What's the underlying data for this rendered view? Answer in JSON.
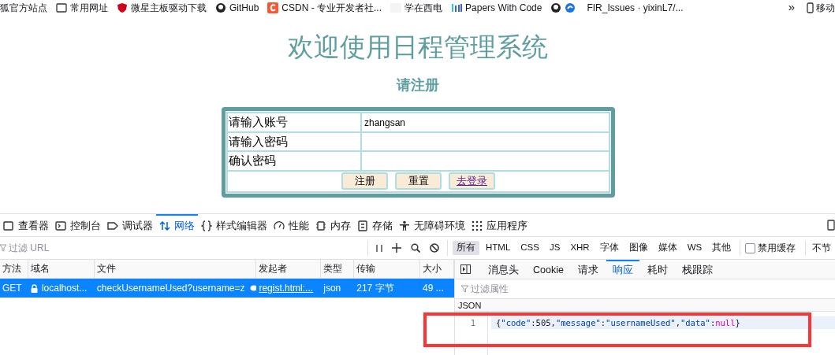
{
  "bookmarks": [
    {
      "label": "狐官方站点"
    },
    {
      "label": "常用网址"
    },
    {
      "label": "微星主板驱动下载"
    },
    {
      "label": "GitHub"
    },
    {
      "label": "CSDN - 专业开发者社..."
    },
    {
      "label": "学在西电"
    },
    {
      "label": "Papers With Code"
    },
    {
      "label": "FIR_Issues · yixinL7/..."
    }
  ],
  "bookmarks_overflow": "»",
  "bookmarks_mobile": "移动",
  "page": {
    "title": "欢迎使用日程管理系统",
    "subtitle": "请注册",
    "form": {
      "rows": [
        {
          "label": "请输入账号",
          "value": "zhangsan"
        },
        {
          "label": "请输入密码",
          "value": ""
        },
        {
          "label": "确认密码",
          "value": ""
        }
      ],
      "buttons": [
        {
          "label": "注册",
          "kind": "button"
        },
        {
          "label": "重置",
          "kind": "button"
        },
        {
          "label": "去登录",
          "kind": "link"
        }
      ]
    }
  },
  "devtools": {
    "tabs": [
      {
        "label": "查看器",
        "selected": false
      },
      {
        "label": "控制台",
        "selected": false
      },
      {
        "label": "调试器",
        "selected": false
      },
      {
        "label": "网络",
        "selected": true
      },
      {
        "label": "样式编辑器",
        "selected": false
      },
      {
        "label": "性能",
        "selected": false
      },
      {
        "label": "内存",
        "selected": false
      },
      {
        "label": "存储",
        "selected": false
      },
      {
        "label": "无障碍环境",
        "selected": false
      },
      {
        "label": "应用程序",
        "selected": false
      }
    ],
    "filter_placeholder": "过滤 URL",
    "type_filters": [
      {
        "label": "所有",
        "selected": true
      },
      {
        "label": "HTML",
        "selected": false
      },
      {
        "label": "CSS",
        "selected": false
      },
      {
        "label": "JS",
        "selected": false
      },
      {
        "label": "XHR",
        "selected": false
      },
      {
        "label": "字体",
        "selected": false
      },
      {
        "label": "图像",
        "selected": false
      },
      {
        "label": "媒体",
        "selected": false
      },
      {
        "label": "WS",
        "selected": false
      },
      {
        "label": "其他",
        "selected": false
      }
    ],
    "disable_cache": {
      "label": "禁用缓存",
      "checked": false
    },
    "throttle": "不节",
    "columns": [
      "方法",
      "域名",
      "文件",
      "发起者",
      "类型",
      "传输",
      "大小"
    ],
    "requests": [
      {
        "selected": true,
        "cells": [
          "GET",
          "localhost...",
          "checkUsernameUsed?username=z",
          "regist.html:...",
          "json",
          "217 字节",
          "49 ..."
        ]
      }
    ],
    "detail_tabs": [
      {
        "label": "消息头",
        "selected": false
      },
      {
        "label": "Cookie",
        "selected": false
      },
      {
        "label": "请求",
        "selected": false
      },
      {
        "label": "响应",
        "selected": true
      },
      {
        "label": "耗时",
        "selected": false
      },
      {
        "label": "栈跟踪",
        "selected": false
      }
    ],
    "detail_filter_placeholder": "过滤属性",
    "response": {
      "section": "JSON",
      "highlighted": true,
      "lines": [
        {
          "number": "1",
          "tokens": [
            {
              "text": "{",
              "kind": "punct"
            },
            {
              "text": "\"code\"",
              "kind": "string"
            },
            {
              "text": ":505,",
              "kind": "punct"
            },
            {
              "text": "\"message\"",
              "kind": "string"
            },
            {
              "text": ":",
              "kind": "punct"
            },
            {
              "text": "\"usernameUsed\"",
              "kind": "string"
            },
            {
              "text": ",",
              "kind": "punct"
            },
            {
              "text": "\"data\"",
              "kind": "string"
            },
            {
              "text": ":",
              "kind": "punct"
            },
            {
              "text": "null",
              "kind": "keyword"
            },
            {
              "text": "}",
              "kind": "punct"
            }
          ]
        }
      ]
    }
  }
}
